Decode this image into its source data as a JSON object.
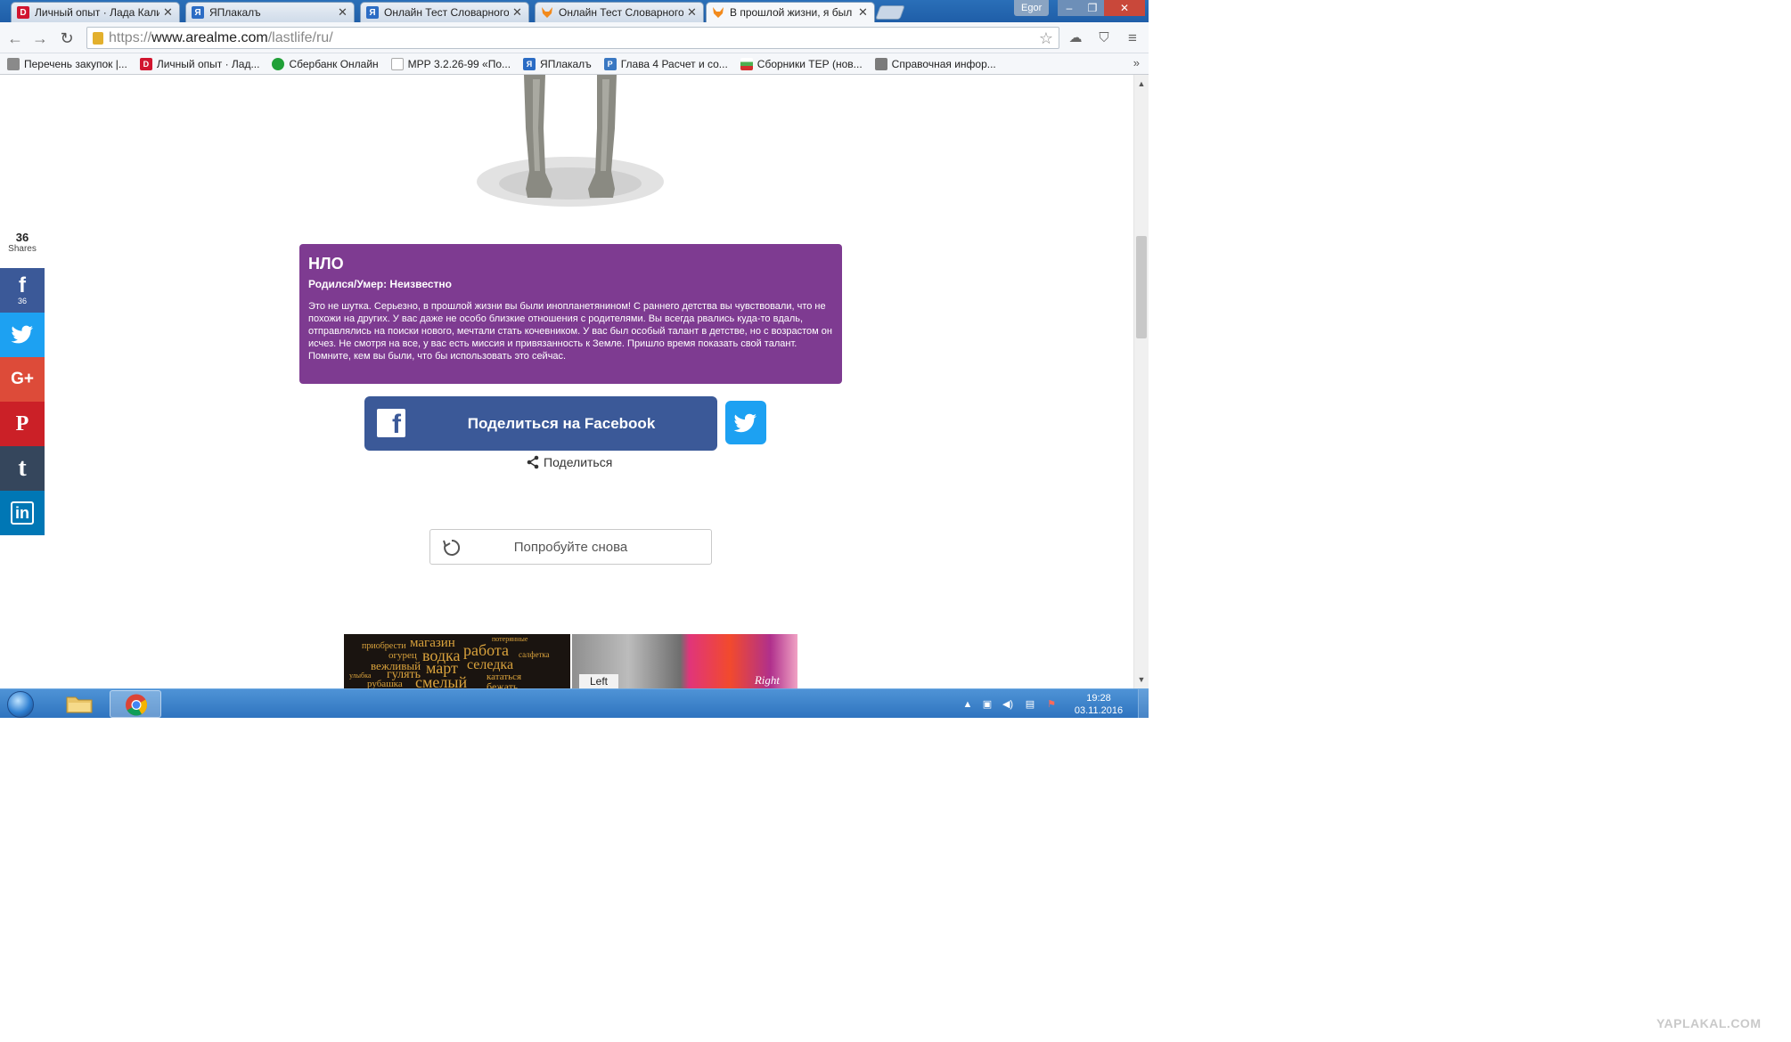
{
  "browser": {
    "tabs": [
      {
        "title": "Личный опыт · Лада Калина",
        "icon": "drive2-icon",
        "color": "#d1152f",
        "letter": "D"
      },
      {
        "title": "ЯПлакалъ",
        "icon": "yaplakal-icon",
        "color": "#2b6cc4",
        "letter": "Я"
      },
      {
        "title": "Онлайн Тест Словарного",
        "icon": "yaplakal-icon",
        "color": "#2b6cc4",
        "letter": "Я"
      },
      {
        "title": "Онлайн Тест Словарного",
        "icon": "arealme-fox-icon",
        "color": "#f28a1c",
        "letter": ""
      },
      {
        "title": "В прошлой жизни, я был",
        "icon": "arealme-fox-icon",
        "color": "#f28a1c",
        "letter": ""
      }
    ],
    "profile_name": "Egor",
    "url": {
      "scheme": "https://",
      "host": "www.arealme.com",
      "path": "/lastlife/ru/"
    },
    "bookmarks": [
      {
        "label": "Перечень закупок |...",
        "color": "#8a8a8a",
        "letter": ""
      },
      {
        "label": "Личный опыт · Лад...",
        "color": "#d1152f",
        "letter": "D"
      },
      {
        "label": "Сбербанк Онлайн",
        "color": "#21a038",
        "letter": ""
      },
      {
        "label": "МРР 3.2.26-99 «По...",
        "color": "#bdbdbd",
        "letter": ""
      },
      {
        "label": "ЯПлакалъ",
        "color": "#2b6cc4",
        "letter": "Я"
      },
      {
        "label": "Глава 4 Расчет и со...",
        "color": "#3a78c2",
        "letter": "P"
      },
      {
        "label": "Сборники ТЕР (нов...",
        "color": "#4caf50",
        "letter": ""
      },
      {
        "label": "Справочная инфор...",
        "color": "#7b7b7b",
        "letter": ""
      }
    ],
    "more_symbol": "»"
  },
  "page": {
    "result": {
      "title": "НЛО",
      "subtitle": "Родился/Умер: Неизвестно",
      "text": "Это не шутка. Серьезно, в прошлой жизни вы были инопланетянином! С раннего детства вы чувствовали, что не похожи на других. У вас даже не особо близкие отношения с родителями. Вы всегда рвались куда-то вдаль, отправлялись на поиски нового, мечтали стать кочевником. У вас был особый талант в детстве, но с возрастом он исчез. Не смотря на все, у вас есть миссия и привязанность к Земле. Пришло время показать свой талант. Помните, кем вы были, что бы использовать это сейчас."
    },
    "facebook_share_label": "Поделиться на Facebook",
    "share_label": "Поделиться",
    "retry_label": "Попробуйте снова",
    "thumb_left": {
      "words": [
        "приобрести",
        "магазин",
        "потерянные",
        "огурец",
        "водка",
        "работа",
        "салфетка",
        "вежливый",
        "март",
        "селедка",
        "гулять",
        "улыбка",
        "смелый",
        "кататься",
        "рубашка",
        "бежать"
      ],
      "label": "Left"
    },
    "thumb_right": {
      "right_label": "Right"
    }
  },
  "share_sidebar": {
    "count": "36",
    "count_label": "Shares",
    "facebook_count": "36",
    "buttons": [
      {
        "name": "facebook",
        "color": "#3b5998",
        "glyph": "f"
      },
      {
        "name": "twitter",
        "color": "#1da1f2",
        "glyph": ""
      },
      {
        "name": "google-plus",
        "color": "#dd4b39",
        "glyph": "G+"
      },
      {
        "name": "pinterest",
        "color": "#cb2027",
        "glyph": "P"
      },
      {
        "name": "tumblr",
        "color": "#35465c",
        "glyph": "t"
      },
      {
        "name": "linkedin",
        "color": "#0077b5",
        "glyph": "in"
      }
    ]
  },
  "taskbar": {
    "time": "19:28",
    "date": "03.11.2016"
  },
  "watermark": "YAPLAKAL.COM"
}
